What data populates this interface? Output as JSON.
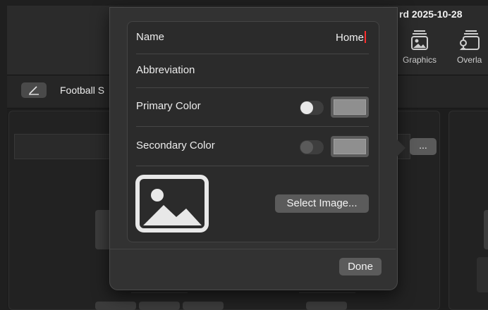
{
  "background": {
    "title": "rd 2025-10-28",
    "toolbar": [
      {
        "label": "Graphics",
        "icon": "graphics-icon"
      },
      {
        "label": "Overla",
        "icon": "overlay-icon"
      }
    ],
    "section_label": "Football S",
    "more_label": "..."
  },
  "popover": {
    "name_label": "Name",
    "name_value": "Home",
    "abbreviation_label": "Abbreviation",
    "primary_color_label": "Primary Color",
    "secondary_color_label": "Secondary Color",
    "select_image_label": "Select Image...",
    "done_label": "Done",
    "primary_toggle_on": true,
    "secondary_toggle_on": false
  },
  "colors": {
    "popover_bg": "#323232",
    "swatch_fill": "#8f8f8f",
    "caret": "#ff2d2d"
  }
}
